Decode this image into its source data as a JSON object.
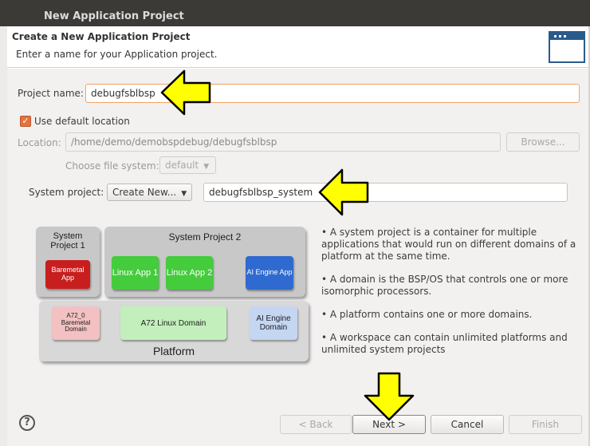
{
  "window": {
    "title": "New Application Project"
  },
  "banner": {
    "title": "Create a New Application Project",
    "description": "Enter a name for your Application project."
  },
  "form": {
    "project_name_label": "Project name:",
    "project_name_value": "debugfsblbsp",
    "use_default_location_label": "Use default location",
    "use_default_location_checked": true,
    "location_label": "Location:",
    "location_value": "/home/demo/demobspdebug/debugfsblbsp",
    "browse_label": "Browse...",
    "file_system_label": "Choose file system:",
    "file_system_value": "default",
    "system_project_label": "System project:",
    "system_project_combo": "Create New...",
    "system_project_value": "debugfsblbsp_system"
  },
  "diagram": {
    "system_project_1": "System Project 1",
    "system_project_2": "System Project 2",
    "baremetal_app": "Baremetal App",
    "linux_app_1": "Linux App 1",
    "linux_app_2": "Linux App 2",
    "ai_engine_app": "AI Engine App",
    "a72_0_domain": "A72_0 Baremetal Domain",
    "a72_linux_domain": "A72 Linux Domain",
    "ai_engine_domain": "AI Engine Domain",
    "platform": "Platform"
  },
  "info": [
    "• A system project is a container for multiple applications that would run on different domains of a platform at the same time.",
    "• A domain is the BSP/OS that controls one or more isomorphic processors.",
    "• A platform contains one or more domains.",
    "• A workspace can contain unlimited platforms and unlimited system projects"
  ],
  "buttons": {
    "help": "?",
    "back": "< Back",
    "next": "Next >",
    "cancel": "Cancel",
    "finish": "Finish"
  },
  "colors": {
    "titlebar": "#3b3a37",
    "dialog_bg": "#f2f1f0",
    "checkbox_accent": "#e0733f",
    "annotation_arrow": "#ffff00"
  }
}
